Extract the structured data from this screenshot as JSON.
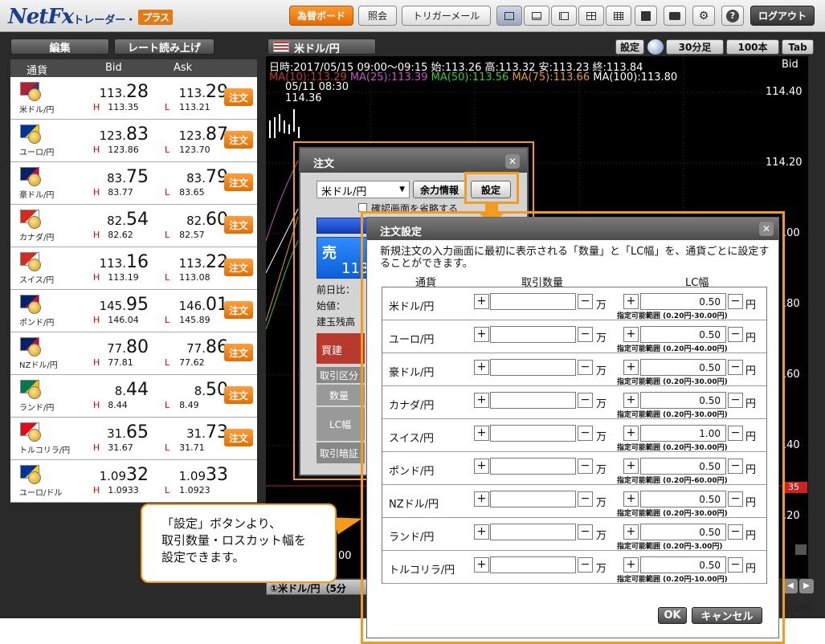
{
  "app": {
    "logo_main": "NetFx",
    "logo_sub": "トレーダー・",
    "logo_plus": "プラス",
    "copyright": "o.,LTD."
  },
  "toolbar": {
    "board": "為替ボード",
    "inquiry": "照会",
    "trigger_mail": "トリガーメール",
    "logout": "ログアウト"
  },
  "left": {
    "edit": "編集",
    "read_rates": "レート読み上げ"
  },
  "table_header": {
    "currency": "通貨",
    "bid": "Bid",
    "ask": "Ask"
  },
  "order_label": "注文",
  "hl": {
    "h": "H",
    "l": "L"
  },
  "rates": [
    {
      "name": "米ドル/円",
      "bid_pre": "113.",
      "bid_big": "28",
      "ask_pre": "113.",
      "ask_big": "29",
      "high": "113.35",
      "low": "113.21",
      "order": true
    },
    {
      "name": "ユーロ/円",
      "bid_pre": "123.",
      "bid_big": "83",
      "ask_pre": "123.",
      "ask_big": "87",
      "high": "123.86",
      "low": "123.70",
      "order": true
    },
    {
      "name": "豪ドル/円",
      "bid_pre": "83.",
      "bid_big": "75",
      "ask_pre": "83.",
      "ask_big": "79",
      "high": "83.77",
      "low": "83.65",
      "order": true
    },
    {
      "name": "カナダ/円",
      "bid_pre": "82.",
      "bid_big": "54",
      "ask_pre": "82.",
      "ask_big": "60",
      "high": "82.62",
      "low": "82.57",
      "order": true
    },
    {
      "name": "スイス/円",
      "bid_pre": "113.",
      "bid_big": "16",
      "ask_pre": "113.",
      "ask_big": "22",
      "high": "113.19",
      "low": "113.08",
      "order": true
    },
    {
      "name": "ポンド/円",
      "bid_pre": "145.",
      "bid_big": "95",
      "ask_pre": "146.",
      "ask_big": "01",
      "high": "146.04",
      "low": "145.89",
      "order": true
    },
    {
      "name": "NZドル/円",
      "bid_pre": "77.",
      "bid_big": "80",
      "ask_pre": "77.",
      "ask_big": "86",
      "high": "77.81",
      "low": "77.62",
      "order": true
    },
    {
      "name": "ランド/円",
      "bid_pre": "8.",
      "bid_big": "44",
      "ask_pre": "8.",
      "ask_big": "50",
      "high": "8.44",
      "low": "8.49",
      "order": true
    },
    {
      "name": "トルコリラ/円",
      "bid_pre": "31.",
      "bid_big": "65",
      "ask_pre": "31.",
      "ask_big": "73",
      "high": "31.67",
      "low": "31.71",
      "order": true
    },
    {
      "name": "ユーロ/ドル",
      "bid_pre": "1.09",
      "bid_big": "32",
      "ask_pre": "1.09",
      "ask_big": "33",
      "high": "1.0933",
      "low": "1.0923",
      "order": false
    }
  ],
  "chart": {
    "tab": "米ドル/円",
    "settings": "設定",
    "period": "30分足",
    "count": "100本",
    "tab_btn": "Tab",
    "info": "日時:2017/05/15 09:00～09:15 始:113.26 高:113.32 安:113.23 終:113.84",
    "bid_label": "Bid",
    "ma10": "MA(10):113.29",
    "ma25": "MA(25):113.39",
    "ma50": "MA(50):113.56",
    "ma75": "MA(75):113.66",
    "ma100": "MA(100):113.80",
    "date_note": "05/11 08:30",
    "peak": "114.36",
    "y_labels": [
      "114.40",
      "114.20",
      ".00",
      ".80",
      ".60",
      ".40",
      ".20"
    ],
    "x_label": "00",
    "bottom_tab": "①米ドル/円（5分",
    "price_tag": "35",
    "colors": {
      "ma10": "#c0392b",
      "ma25": "#c651c6",
      "ma50": "#33cc33",
      "ma75": "#e39a2c",
      "ma100": "#ffffff",
      "candle": "#ffffff"
    }
  },
  "order_window": {
    "title": "注文",
    "pair": "米ドル/円",
    "margin_btn": "余力情報",
    "settings_btn": "設定",
    "confirm": "確認画面を省略する",
    "sell": "売",
    "sell_price": "113",
    "prev": "前日比：",
    "open": "始値：",
    "position": "建玉残高",
    "buy": "買建",
    "trade_type": "取引区分",
    "qty": "数量",
    "lc": "LC幅",
    "pin": "取引暗証"
  },
  "settings": {
    "title": "注文設定",
    "desc": "新規注文の入力画面に最初に表示される「数量」と「LC幅」を、通貨ごとに設定することができます。",
    "h_currency": "通貨",
    "h_qty": "取引数量",
    "h_lc": "LC幅",
    "plus": "+",
    "minus": "−",
    "unit_man": "万",
    "unit_yen": "円",
    "ok": "OK",
    "cancel": "キャンセル",
    "rows": [
      {
        "name": "米ドル/円",
        "lc": "0.50",
        "range": "指定可能範囲 (0.20円-30.00円)"
      },
      {
        "name": "ユーロ/円",
        "lc": "0.50",
        "range": "指定可能範囲 (0.20円-40.00円)"
      },
      {
        "name": "豪ドル/円",
        "lc": "0.50",
        "range": "指定可能範囲 (0.20円-30.00円)"
      },
      {
        "name": "カナダ/円",
        "lc": "0.50",
        "range": "指定可能範囲 (0.20円-30.00円)"
      },
      {
        "name": "スイス/円",
        "lc": "1.00",
        "range": "指定可能範囲 (0.20円-30.00円)"
      },
      {
        "name": "ポンド/円",
        "lc": "0.50",
        "range": "指定可能範囲 (0.20円-60.00円)"
      },
      {
        "name": "NZドル/円",
        "lc": "0.50",
        "range": "指定可能範囲 (0.20円-30.00円)"
      },
      {
        "name": "ランド/円",
        "lc": "0.50",
        "range": "指定可能範囲 (0.20円-3.00円)"
      },
      {
        "name": "トルコリラ/円",
        "lc": "0.50",
        "range": "指定可能範囲 (0.20円-10.00円)"
      }
    ]
  },
  "callout": {
    "line1": "「設定」ボタンより、",
    "line2": "取引数量・ロスカット幅を",
    "line3": "設定できます。"
  },
  "accent": "#f29b1d"
}
